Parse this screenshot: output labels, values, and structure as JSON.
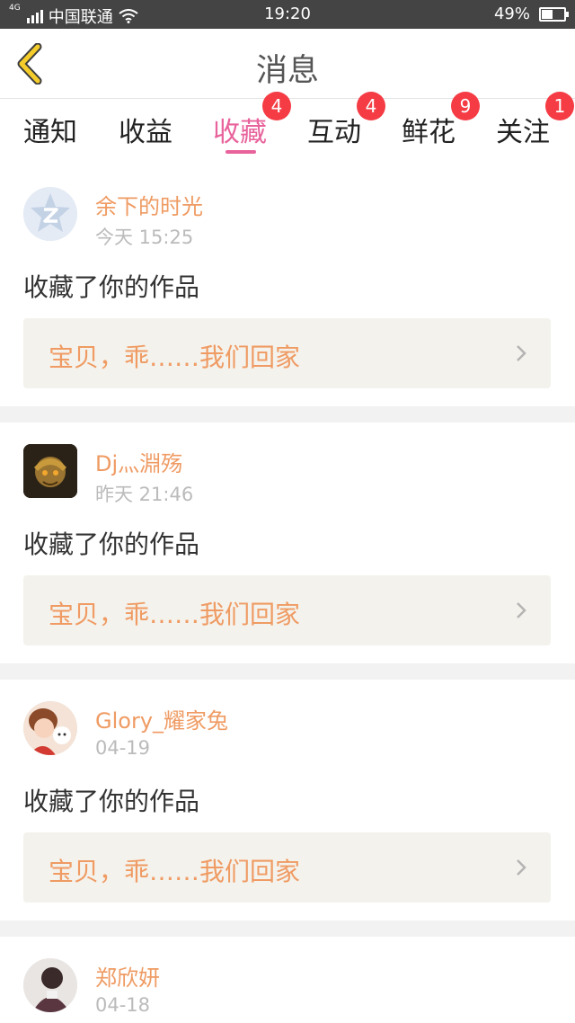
{
  "status_bar": {
    "network": "4G",
    "carrier": "中国联通",
    "time": "19:20",
    "battery": "49%",
    "battery_level": 0.49
  },
  "header": {
    "title": "消息"
  },
  "tabs": [
    {
      "label": "通知",
      "badge": ""
    },
    {
      "label": "收益",
      "badge": ""
    },
    {
      "label": "收藏",
      "badge": "4",
      "active": true
    },
    {
      "label": "互动",
      "badge": "4"
    },
    {
      "label": "鲜花",
      "badge": "9"
    },
    {
      "label": "关注",
      "badge": "1"
    }
  ],
  "feed": [
    {
      "user": "余下的时光",
      "time": "今天 15:25",
      "action": "收藏了你的作品",
      "work": "宝贝，乖……我们回家",
      "avatar": "default-z-avatar"
    },
    {
      "user": "Dj灬淵殇",
      "time": "昨天 21:46",
      "action": "收藏了你的作品",
      "work": "宝贝，乖……我们回家",
      "avatar": "warrior-avatar"
    },
    {
      "user": "Glory_耀家兔",
      "time": "04-19",
      "action": "收藏了你的作品",
      "work": "宝贝，乖……我们回家",
      "avatar": "girl-with-dog-avatar"
    },
    {
      "user": "郑欣妍",
      "time": "04-18",
      "action": "",
      "work": "",
      "avatar": "dark-figure-avatar"
    }
  ],
  "colors": {
    "accent": "#e8639c",
    "badge": "#f53b44",
    "username": "#ef9b63",
    "back_icon": "#f5cd2a",
    "card_bg": "#f4f2ec",
    "separator": "#f2f2f2"
  }
}
